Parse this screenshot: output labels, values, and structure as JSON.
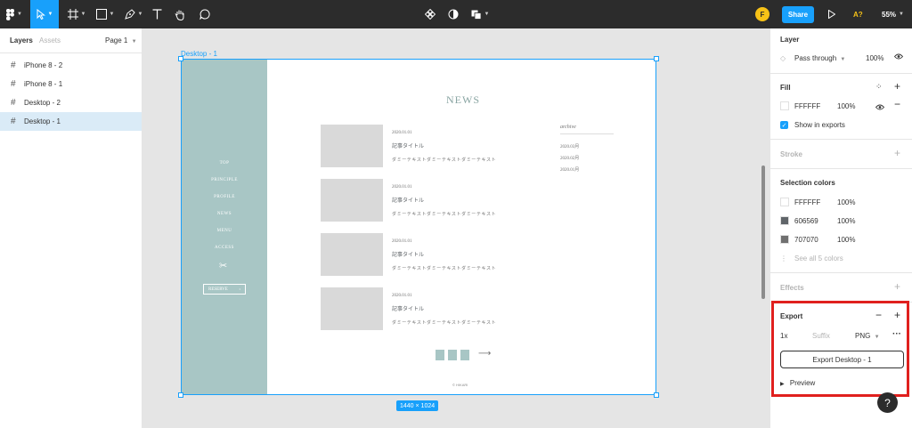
{
  "toolbar": {
    "zoom": "55%",
    "share_label": "Share",
    "avatar_initial": "F",
    "accessibility_label": "A?"
  },
  "left_panel": {
    "tabs": {
      "layers": "Layers",
      "assets": "Assets"
    },
    "page_selector": "Page 1",
    "layers": [
      {
        "name": "iPhone 8 - 2",
        "selected": false
      },
      {
        "name": "iPhone 8 - 1",
        "selected": false
      },
      {
        "name": "Desktop - 2",
        "selected": false
      },
      {
        "name": "Desktop - 1",
        "selected": true
      }
    ]
  },
  "canvas": {
    "frame_label": "Desktop - 1",
    "frame_size": "1440 × 1024",
    "design": {
      "nav": [
        "TOP",
        "PRINCIPLE",
        "PROFILE",
        "NEWS",
        "MENU",
        "ACCESS"
      ],
      "reserve_label": "RESERVE",
      "reserve_arrow": "›",
      "news_title": "NEWS",
      "articles": [
        {
          "date": "2020.01.01",
          "title": "記事タイトル",
          "text": "ダミーテキストダミーテキストダミーテキスト"
        },
        {
          "date": "2020.01.01",
          "title": "記事タイトル",
          "text": "ダミーテキストダミーテキストダミーテキスト"
        },
        {
          "date": "2020.01.01",
          "title": "記事タイトル",
          "text": "ダミーテキストダミーテキストダミーテキスト"
        },
        {
          "date": "2020.01.01",
          "title": "記事タイトル",
          "text": "ダミーテキストダミーテキストダミーテキスト"
        }
      ],
      "archive_title": "archive",
      "archive_items": [
        "2020.03月",
        "2020.02月",
        "2020.01月"
      ],
      "copyright": "© HIKARI"
    }
  },
  "right_panel": {
    "layer": {
      "title": "Layer",
      "blend_mode": "Pass through",
      "opacity": "100%"
    },
    "fill": {
      "title": "Fill",
      "hex": "FFFFFF",
      "opacity": "100%",
      "show_in_exports": "Show in exports"
    },
    "stroke": {
      "title": "Stroke"
    },
    "selection_colors": {
      "title": "Selection colors",
      "colors": [
        {
          "hex": "FFFFFF",
          "opacity": "100%",
          "swatch": "#ffffff"
        },
        {
          "hex": "606569",
          "opacity": "100%",
          "swatch": "#606569"
        },
        {
          "hex": "707070",
          "opacity": "100%",
          "swatch": "#707070"
        }
      ],
      "see_all": "See all 5 colors"
    },
    "effects": {
      "title": "Effects"
    },
    "export": {
      "title": "Export",
      "scale": "1x",
      "suffix_placeholder": "Suffix",
      "format": "PNG",
      "button_label": "Export Desktop - 1",
      "preview_label": "Preview"
    }
  },
  "help_label": "?",
  "colors": {
    "accent": "#18a0fb",
    "toolbar_bg": "#2c2c2c",
    "highlight": "#e0201e",
    "sidebar_teal": "#a8c6c5"
  }
}
